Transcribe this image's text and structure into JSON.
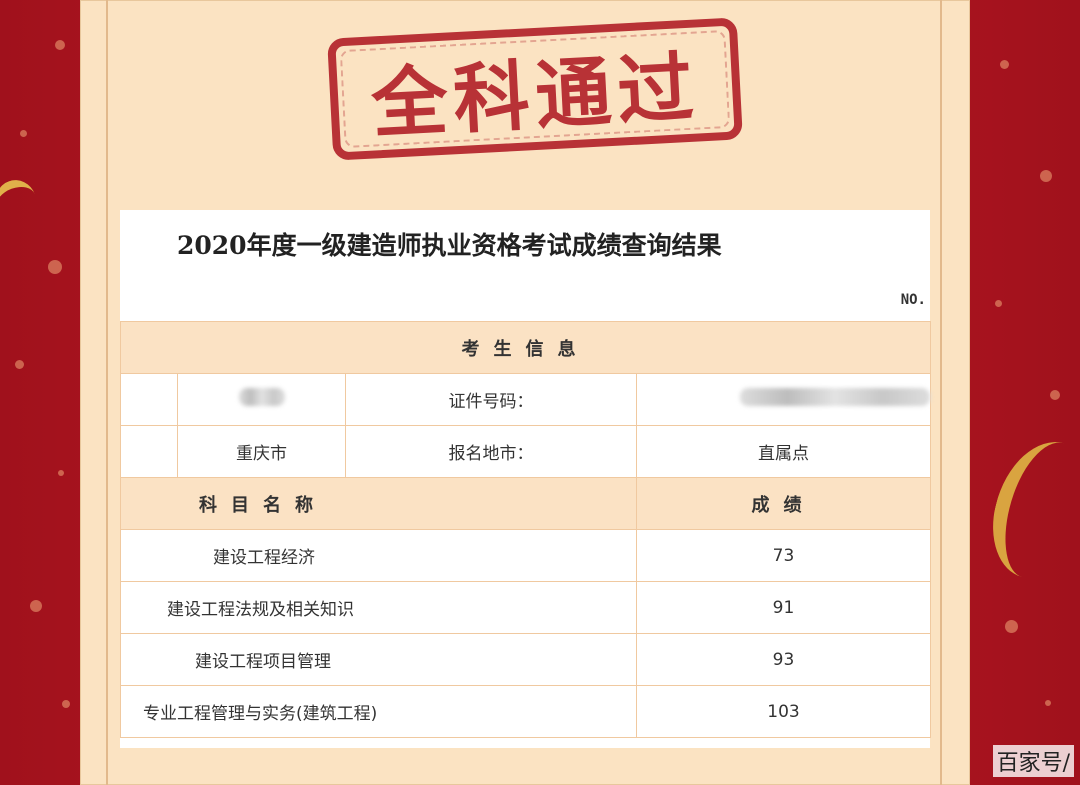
{
  "stamp": "全科通过",
  "title": "2020年度一级建造师执业资格考试成绩查询结果",
  "no_label": "NO.",
  "candidate_section": "考生信息",
  "id_label": "证件号码：",
  "city": "重庆市",
  "region_label": "报名地市：",
  "site": "直属点",
  "subject_header": "科目名称",
  "score_header": "成绩",
  "subjects": [
    {
      "name": "建设工程经济",
      "score": "73"
    },
    {
      "name": "建设工程法规及相关知识",
      "score": "91"
    },
    {
      "name": "建设工程项目管理",
      "score": "93"
    },
    {
      "name": "专业工程管理与实务(建筑工程)",
      "score": "103"
    }
  ],
  "watermark": "百家号/"
}
